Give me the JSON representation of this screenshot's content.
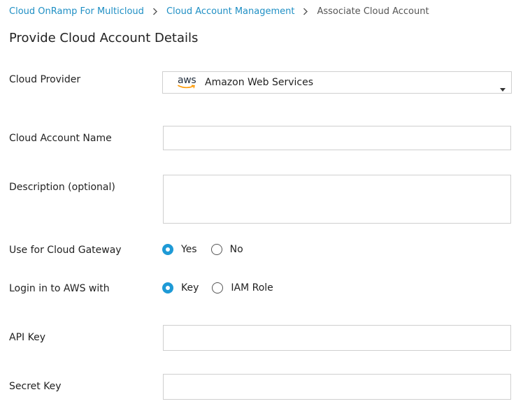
{
  "breadcrumb": {
    "items": [
      "Cloud OnRamp For Multicloud",
      "Cloud Account Management"
    ],
    "current": "Associate Cloud Account"
  },
  "page_title": "Provide Cloud Account Details",
  "form": {
    "cloud_provider": {
      "label": "Cloud Provider",
      "selected": "Amazon Web Services",
      "logo_text": "aws",
      "logo_icon": "aws-logo-icon",
      "caret_icon": "caret-down-icon"
    },
    "account_name": {
      "label": "Cloud Account Name",
      "value": ""
    },
    "description": {
      "label": "Description (optional)",
      "value": ""
    },
    "use_gateway": {
      "label": "Use for Cloud Gateway",
      "options": [
        "Yes",
        "No"
      ],
      "selected": "Yes"
    },
    "login_with": {
      "label": "Login in to AWS with",
      "options": [
        "Key",
        "IAM Role"
      ],
      "selected": "Key"
    },
    "api_key": {
      "label": "API Key",
      "value": ""
    },
    "secret_key": {
      "label": "Secret Key",
      "value": ""
    }
  },
  "colors": {
    "link": "#1f8fc4",
    "radio_selected": "#1e9ad6",
    "aws_smile": "#f90",
    "border": "#cfcfcf"
  }
}
